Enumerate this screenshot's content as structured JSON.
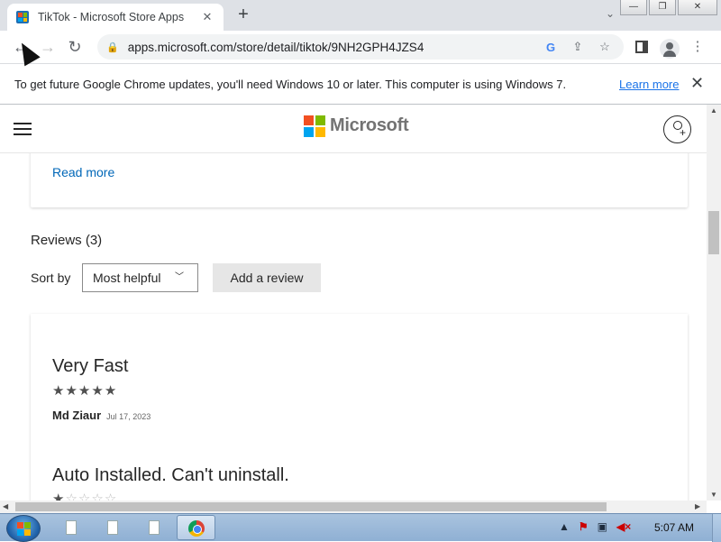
{
  "browser": {
    "tab_title": "TikTok - Microsoft Store Apps",
    "tab_close": "✕",
    "new_tab": "+",
    "tab_search": "⌄",
    "window_buttons": {
      "minimize": "—",
      "maximize": "❐",
      "close": "✕"
    },
    "url": "apps.microsoft.com/store/detail/tiktok/9NH2GPH4JZS4",
    "nav": {
      "back": "←",
      "forward": "→",
      "reload": "↻"
    }
  },
  "infobar": {
    "message": "To get future Google Chrome updates, you'll need Windows 10 or later. This computer is using Windows 7.",
    "link": "Learn more",
    "close": "✕"
  },
  "store": {
    "brand": "Microsoft",
    "read_more": "Read more",
    "reviews_heading": "Reviews (3)",
    "sort_label": "Sort by",
    "sort_value": "Most helpful",
    "add_review": "Add a review",
    "reviews": [
      {
        "title": "Very Fast",
        "rating": 5,
        "author": "Md Ziaur",
        "date": "Jul 17, 2023"
      },
      {
        "title": "Auto Installed. Can't uninstall.",
        "rating": 1
      }
    ]
  },
  "taskbar": {
    "clock": "5:07 AM"
  },
  "colors": {
    "ms_red": "#f25022",
    "ms_green": "#7fba00",
    "ms_blue": "#00a4ef",
    "ms_yellow": "#ffb900",
    "link_blue": "#0067b8"
  }
}
